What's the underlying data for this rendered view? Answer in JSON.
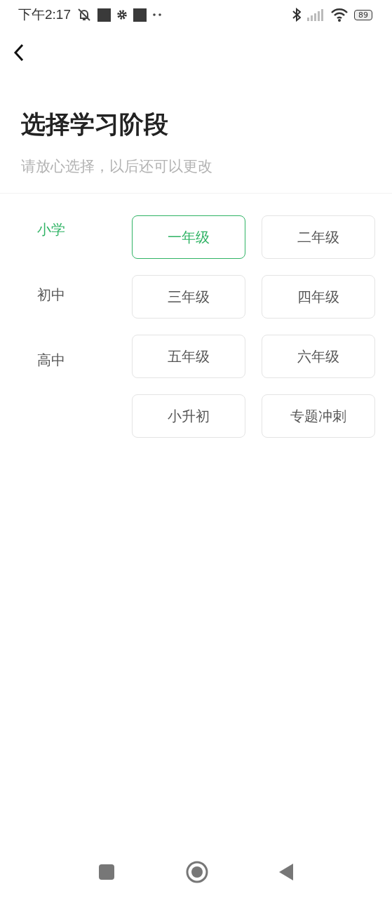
{
  "status_bar": {
    "time": "下午2:17",
    "battery": "89"
  },
  "title": "选择学习阶段",
  "subtitle": "请放心选择，以后还可以更改",
  "stages": [
    {
      "label": "小学",
      "selected": true
    },
    {
      "label": "初中",
      "selected": false
    },
    {
      "label": "高中",
      "selected": false
    }
  ],
  "grades": [
    {
      "label": "一年级",
      "selected": true
    },
    {
      "label": "二年级",
      "selected": false
    },
    {
      "label": "三年级",
      "selected": false
    },
    {
      "label": "四年级",
      "selected": false
    },
    {
      "label": "五年级",
      "selected": false
    },
    {
      "label": "六年级",
      "selected": false
    },
    {
      "label": "小升初",
      "selected": false
    },
    {
      "label": "专题冲刺",
      "selected": false
    }
  ]
}
